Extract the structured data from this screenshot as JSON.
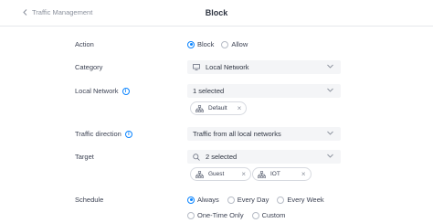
{
  "header": {
    "back_label": "Traffic Management",
    "title": "Block"
  },
  "action": {
    "label": "Action",
    "options": [
      "Block",
      "Allow"
    ],
    "selected": "Block"
  },
  "category": {
    "label": "Category",
    "value": "Local Network"
  },
  "local_network": {
    "label": "Local Network",
    "value": "1 selected",
    "chips": [
      "Default"
    ]
  },
  "traffic_direction": {
    "label": "Traffic direction",
    "value": "Traffic from all local networks"
  },
  "target": {
    "label": "Target",
    "value": "2 selected",
    "chips": [
      "Guest",
      "IOT"
    ]
  },
  "schedule": {
    "label": "Schedule",
    "options": [
      "Always",
      "Every Day",
      "Every Week",
      "One-Time Only",
      "Custom"
    ],
    "selected": "Always"
  },
  "colors": {
    "accent": "#0a84ff",
    "field_bg": "#f4f5f7"
  }
}
